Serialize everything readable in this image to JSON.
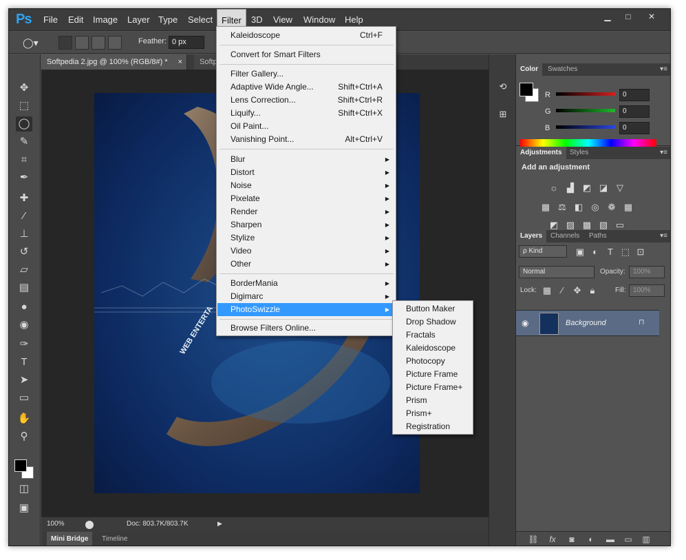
{
  "app": {
    "logo": "Ps"
  },
  "menubar": {
    "items": [
      "File",
      "Edit",
      "Image",
      "Layer",
      "Type",
      "Select",
      "Filter",
      "3D",
      "View",
      "Window",
      "Help"
    ],
    "active": "Filter"
  },
  "window_controls": {
    "minimize": "▁",
    "maximize": "□",
    "close": "✕"
  },
  "options": {
    "feather_label": "Feather:",
    "feather_value": "0 px"
  },
  "doc_tabs": [
    "Softpedia 2.jpg @ 100% (RGB/8#) *",
    "Softpe"
  ],
  "doc_tab_close": "×",
  "status": {
    "zoom": "100%",
    "doc": "Doc: 803.7K/803.7K"
  },
  "bottom_tabs": [
    "Mini Bridge",
    "Timeline"
  ],
  "filter_menu": {
    "top": [
      {
        "label": "Kaleidoscope",
        "shortcut": "Ctrl+F"
      }
    ],
    "smart": [
      {
        "label": "Convert for Smart Filters"
      }
    ],
    "gallery": [
      {
        "label": "Filter Gallery..."
      },
      {
        "label": "Adaptive Wide Angle...",
        "shortcut": "Shift+Ctrl+A"
      },
      {
        "label": "Lens Correction...",
        "shortcut": "Shift+Ctrl+R"
      },
      {
        "label": "Liquify...",
        "shortcut": "Shift+Ctrl+X"
      },
      {
        "label": "Oil Paint..."
      },
      {
        "label": "Vanishing Point...",
        "shortcut": "Alt+Ctrl+V"
      }
    ],
    "groups": [
      "Blur",
      "Distort",
      "Noise",
      "Pixelate",
      "Render",
      "Sharpen",
      "Stylize",
      "Video",
      "Other"
    ],
    "plugins": [
      "BorderMania",
      "Digimarc",
      "PhotoSwizzle"
    ],
    "online": "Browse Filters Online..."
  },
  "photoswizzle_submenu": [
    "Button Maker",
    "Drop Shadow",
    "Fractals",
    "Kaleidoscope",
    "Photocopy",
    "Picture Frame",
    "Picture Frame+",
    "Prism",
    "Prism+",
    "Registration"
  ],
  "color_panel": {
    "tabs": [
      "Color",
      "Swatches"
    ],
    "channels": [
      {
        "label": "R",
        "value": "0",
        "color": "#d42020"
      },
      {
        "label": "G",
        "value": "0",
        "color": "#1fb82a"
      },
      {
        "label": "B",
        "value": "0",
        "color": "#2a46e0"
      }
    ]
  },
  "adjustments_panel": {
    "tabs": [
      "Adjustments",
      "Styles"
    ],
    "title": "Add an adjustment"
  },
  "layers_panel": {
    "tabs": [
      "Layers",
      "Channels",
      "Paths"
    ],
    "kind": "ρ Kind",
    "blend_mode": "Normal",
    "opacity_label": "Opacity:",
    "opacity_value": "100%",
    "lock_label": "Lock:",
    "fill_label": "Fill:",
    "fill_value": "100%",
    "layer_name": "Background"
  },
  "canvas_text": "WEB ENTERTA",
  "accent": {
    "highlight": "#3399ff",
    "ps_blue": "#2fa3f0"
  }
}
